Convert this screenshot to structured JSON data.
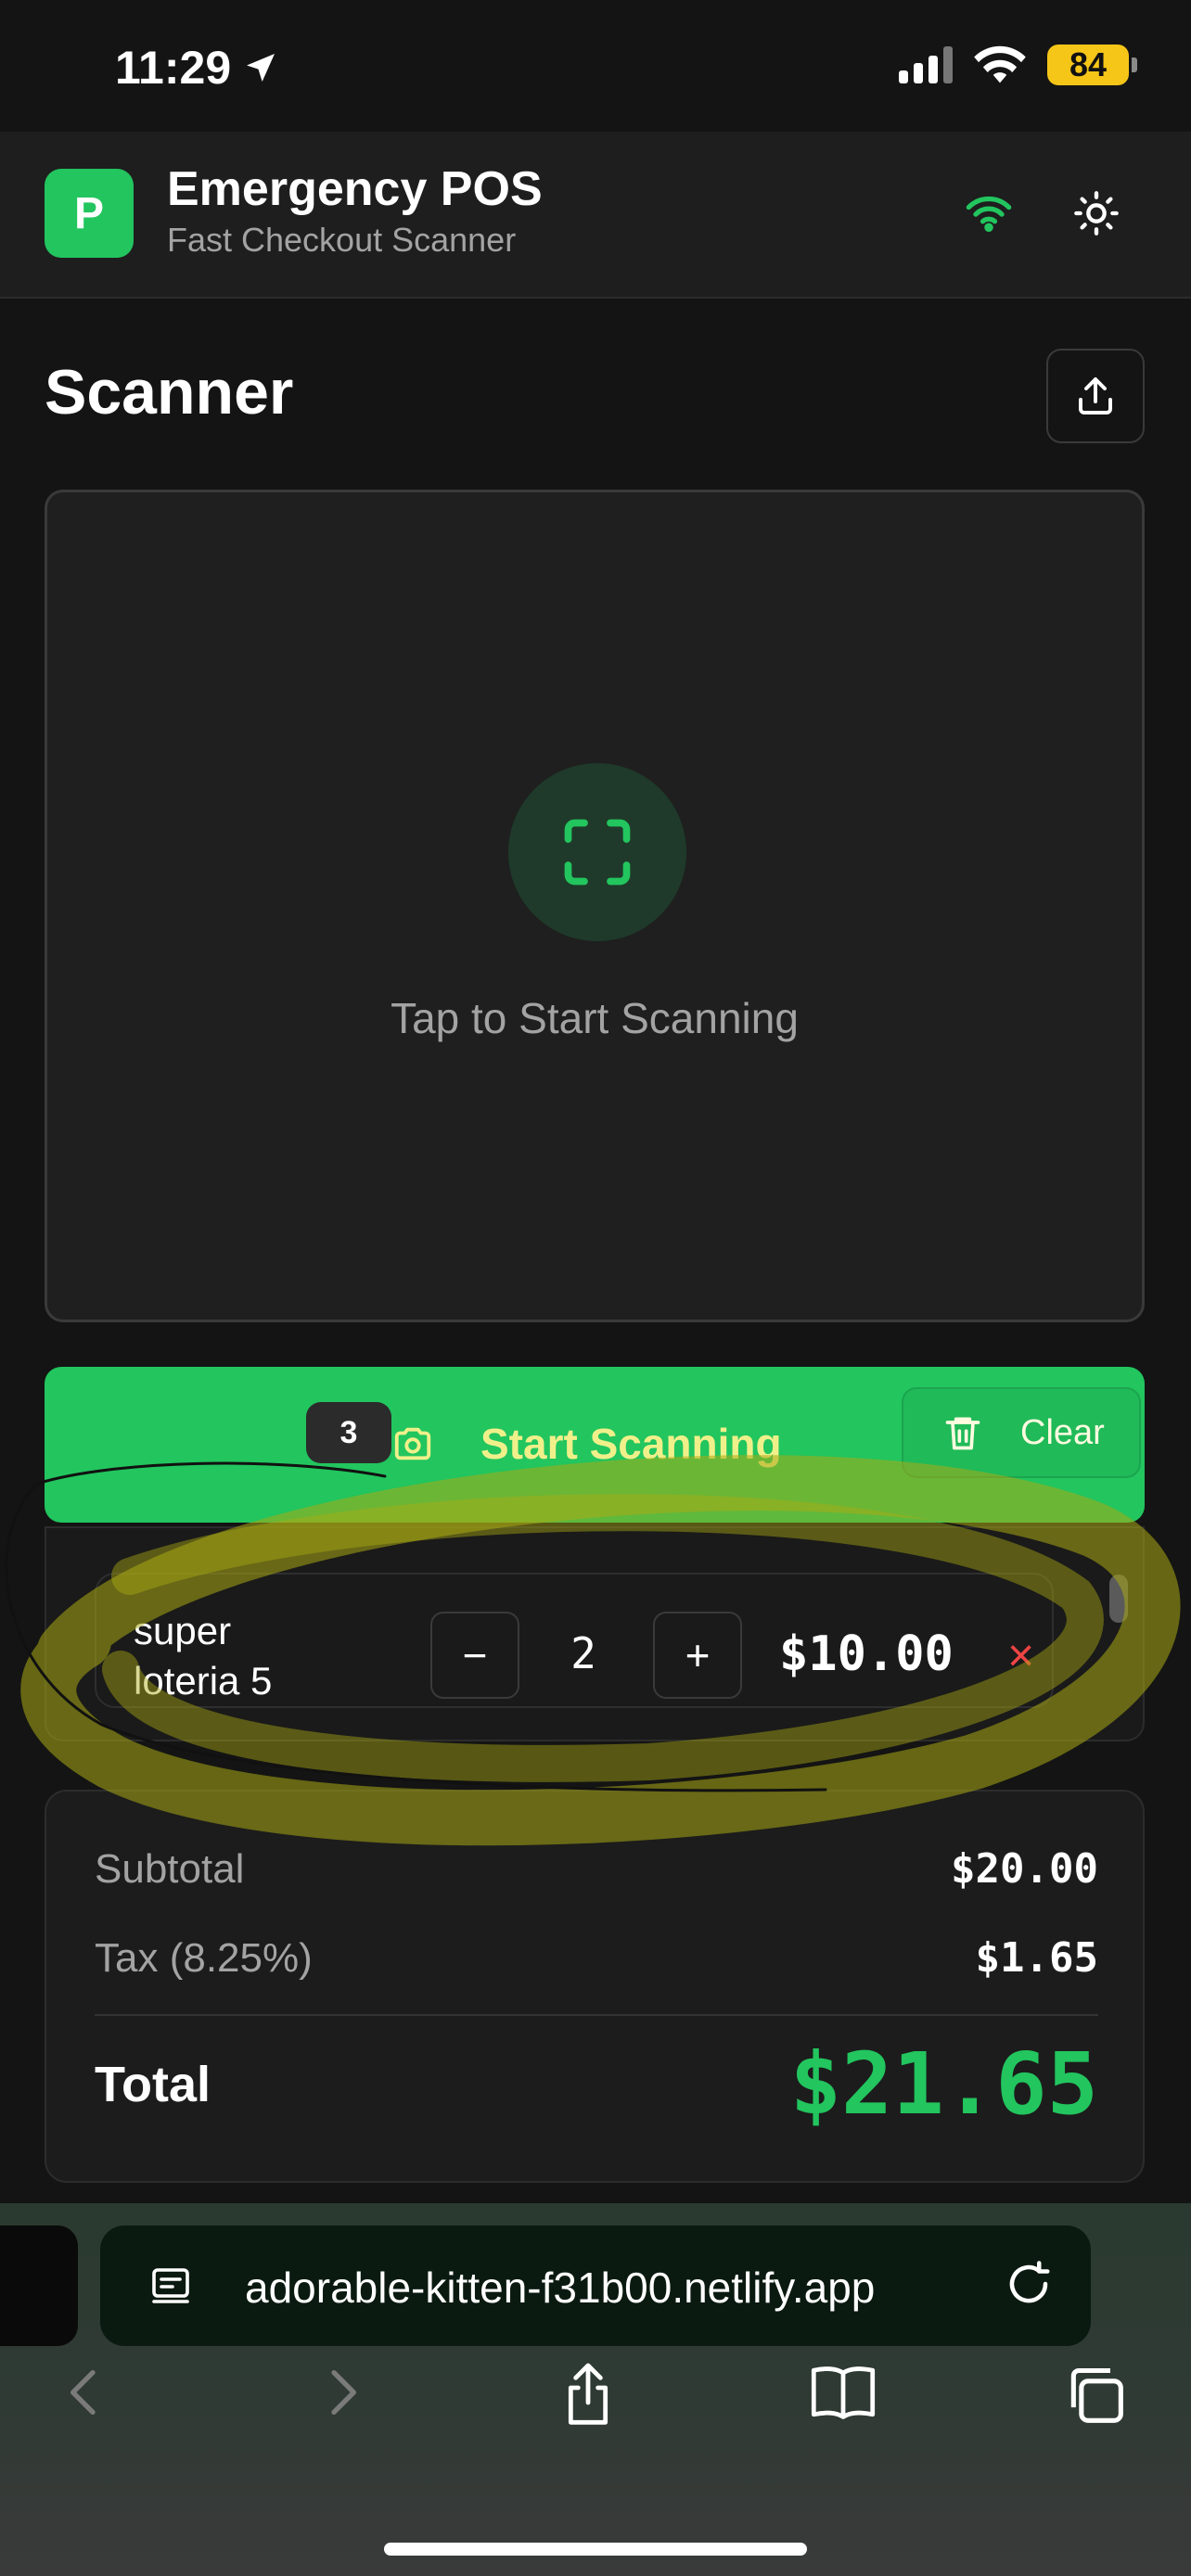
{
  "status_bar": {
    "time": "11:29",
    "battery": "84"
  },
  "app": {
    "logo_letter": "P",
    "title": "Emergency POS",
    "subtitle": "Fast Checkout Scanner"
  },
  "scanner": {
    "section_title": "Scanner",
    "prompt": "Tap to Start Scanning"
  },
  "actions": {
    "badge_count": "3",
    "start_label": "Start Scanning",
    "clear_label": "Clear"
  },
  "cart": {
    "items": [
      {
        "name": "super loteria 5",
        "quantity": "2",
        "price": "$10.00"
      }
    ],
    "minus_label": "−",
    "plus_label": "+",
    "remove_label": "×"
  },
  "summary": {
    "subtotal_label": "Subtotal",
    "subtotal_value": "$20.00",
    "tax_label": "Tax (8.25%)",
    "tax_value": "$1.65",
    "total_label": "Total",
    "total_value": "$21.65"
  },
  "browser": {
    "url": "adorable-kitten-f31b00.netlify.app"
  },
  "colors": {
    "accent": "#22c55e",
    "danger": "#ef4444",
    "background": "#141414",
    "battery": "#f5c518"
  }
}
